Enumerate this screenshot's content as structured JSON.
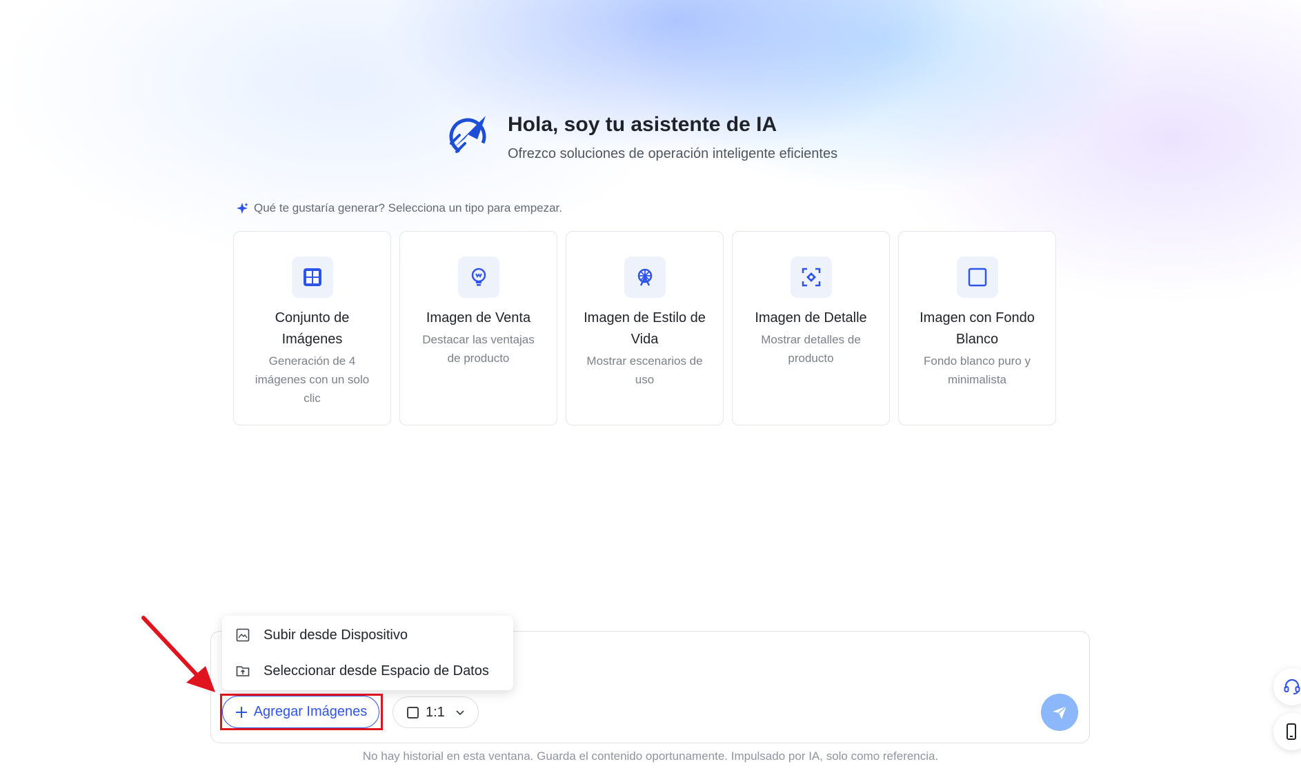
{
  "hero": {
    "title": "Hola, soy tu asistente de IA",
    "subtitle": "Ofrezco soluciones de operación inteligente eficientes",
    "logo_icon": "rocket-logo-icon"
  },
  "prompt": {
    "icon": "sparkle-icon",
    "text": "Qué te gustaría generar? Selecciona un tipo para empezar."
  },
  "cards": [
    {
      "icon": "grid-icon",
      "title": "Conjunto de Imágenes",
      "desc": "Generación de 4 imágenes con un solo clic"
    },
    {
      "icon": "lightbulb-icon",
      "title": "Imagen de Venta",
      "desc": "Destacar las ventajas de producto"
    },
    {
      "icon": "ferris-wheel-icon",
      "title": "Imagen de Estilo de Vida",
      "desc": "Mostrar escenarios de uso"
    },
    {
      "icon": "focus-detail-icon",
      "title": "Imagen de Detalle",
      "desc": "Mostrar detalles de producto"
    },
    {
      "icon": "square-icon",
      "title": "Imagen con Fondo Blanco",
      "desc": "Fondo blanco puro y minimalista"
    }
  ],
  "upload_menu": {
    "items": [
      {
        "icon": "image-upload-icon",
        "label": "Subir desde Dispositivo"
      },
      {
        "icon": "folder-upload-icon",
        "label": "Seleccionar desde Espacio de Datos"
      }
    ]
  },
  "toolbar": {
    "add_images_label": "Agregar Imágenes",
    "ratio_label": "1:1",
    "send_icon": "send-icon"
  },
  "footer": {
    "text": "No hay historial en esta ventana. Guarda el contenido oportunamente. Impulsado por IA, solo como referencia."
  },
  "side_buttons": [
    "headset-icon",
    "mobile-icon"
  ],
  "colors": {
    "accent": "#2f54eb",
    "send": "#8cb8fb",
    "highlight": "#e0141e",
    "card_icon_bg": "#eef2fb"
  }
}
